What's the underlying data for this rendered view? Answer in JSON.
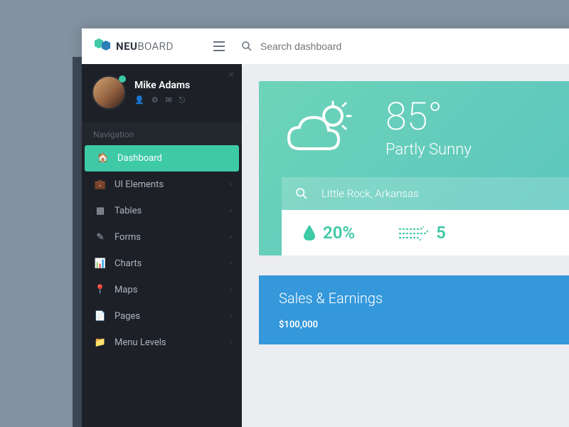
{
  "brand": {
    "bold": "NEU",
    "light": "BOARD"
  },
  "search": {
    "placeholder": "Search dashboard"
  },
  "profile": {
    "name": "Mike Adams",
    "icons": [
      "user",
      "gear",
      "mail",
      "logout"
    ]
  },
  "nav": {
    "label": "Navigation",
    "items": [
      {
        "label": "Dashboard",
        "icon": "home",
        "active": true
      },
      {
        "label": "UI Elements",
        "icon": "briefcase"
      },
      {
        "label": "Tables",
        "icon": "table"
      },
      {
        "label": "Forms",
        "icon": "edit"
      },
      {
        "label": "Charts",
        "icon": "chart"
      },
      {
        "label": "Maps",
        "icon": "pin"
      },
      {
        "label": "Pages",
        "icon": "file"
      },
      {
        "label": "Menu Levels",
        "icon": "folder"
      }
    ]
  },
  "weather": {
    "temp": "85°",
    "condition": "Partly Sunny",
    "location": "Little Rock, Arkansas",
    "humidity": "20%",
    "wind": "5"
  },
  "sales": {
    "title": "Sales & Earnings",
    "value": "$100,000"
  }
}
